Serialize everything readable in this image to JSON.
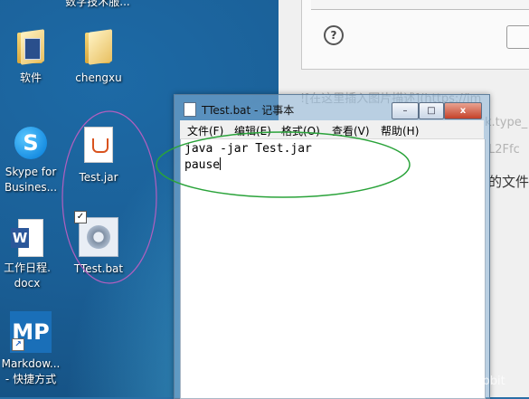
{
  "desktop": {
    "top_label": "数字技术服...",
    "icons": [
      {
        "label": "软件",
        "kind": "folder-icon"
      },
      {
        "label": "chengxu",
        "kind": "folder-icon"
      },
      {
        "label_line1": "Skype for",
        "label_line2": "Busines...",
        "kind": "skype-icon"
      },
      {
        "label": "Test.jar",
        "kind": "jar-file-icon"
      },
      {
        "label_line1": "工作日程.",
        "label_line2": "docx",
        "kind": "word-document-icon"
      },
      {
        "label": "TTest.bat",
        "kind": "batch-file-icon"
      },
      {
        "label_line1": "Markdow...",
        "label_line2": "- 快捷方式",
        "kind": "markdown-app-icon"
      }
    ]
  },
  "background_window": {
    "help_glyph": "?",
    "blurred_lines": [
      "![在这里插入图片描述](https://im",
      "k.type_",
      "L2Ffc",
      "的文件"
    ]
  },
  "notepad": {
    "title": "TTest.bat - 记事本",
    "window_buttons": {
      "minimize": "–",
      "maximize": "□",
      "close": "x"
    },
    "menu": [
      "文件(F)",
      "编辑(E)",
      "格式(O)",
      "查看(V)",
      "帮助(H)"
    ],
    "content_lines": [
      "java -jar Test.jar",
      "pause"
    ]
  },
  "watermark": "https://blog.csdn.net/a_short_tail_rabbit",
  "colors": {
    "annotation_green": "#2aa33a",
    "annotation_purple": "#b25fbf"
  }
}
